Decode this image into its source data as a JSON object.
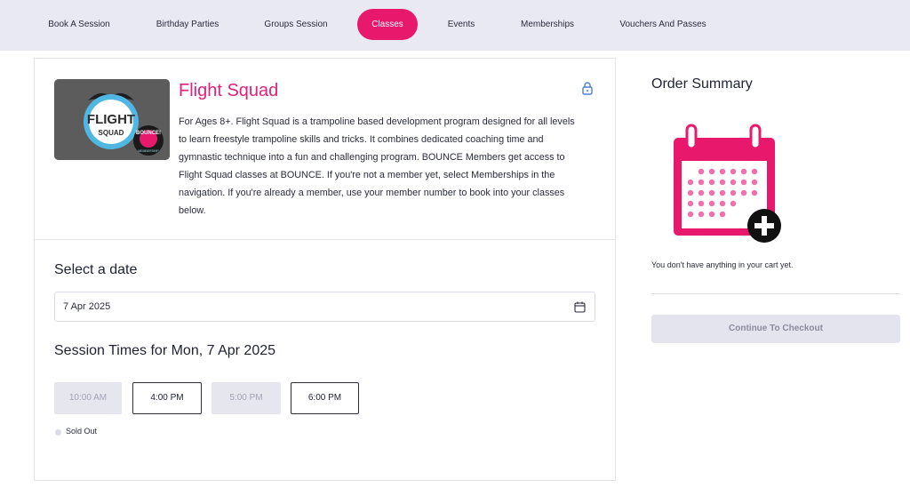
{
  "nav": {
    "items": [
      {
        "label": "Book A Session",
        "active": false
      },
      {
        "label": "Birthday Parties",
        "active": false
      },
      {
        "label": "Groups Session",
        "active": false
      },
      {
        "label": "Classes",
        "active": true
      },
      {
        "label": "Events",
        "active": false
      },
      {
        "label": "Memberships",
        "active": false
      },
      {
        "label": "Vouchers And Passes",
        "active": false
      }
    ]
  },
  "class": {
    "title": "Flight Squad",
    "description": "For Ages 8+. Flight Squad is a trampoline based development program designed for all levels to learn freestyle trampoline skills and tricks. It combines dedicated coaching time and gymnastic technique into a fun and challenging program. BOUNCE Members get access to Flight Squad classes at BOUNCE. If you're not a member yet, select Memberships in the navigation. If you're already a member, use your member number to book into your classes below.",
    "image_text": {
      "top": "FLIGHT",
      "bottom": "SQUAD",
      "badge": "BOUNCE!",
      "badge_sub": "MEMBERSHIP"
    },
    "lock_icon": "lock-icon"
  },
  "date": {
    "label": "Select a date",
    "value": "7 Apr 2025",
    "icon": "calendar-icon"
  },
  "sessions": {
    "title": "Session Times for Mon, 7 Apr 2025",
    "slots": [
      {
        "time": "10:00 AM",
        "status": "sold-out"
      },
      {
        "time": "4:00 PM",
        "status": "available"
      },
      {
        "time": "5:00 PM",
        "status": "sold-out"
      },
      {
        "time": "6:00 PM",
        "status": "available"
      }
    ],
    "legend": "Sold Out"
  },
  "order": {
    "title": "Order Summary",
    "empty_text": "You don't have anything in your cart yet.",
    "checkout_label": "Continue To Checkout",
    "illustration_icon": "calendar-add-icon"
  },
  "colors": {
    "accent": "#e8186d",
    "nav_bg": "#e9e9f3",
    "sold_out_bg": "#e6e6ef",
    "disabled_button_bg": "#e4e4ee"
  }
}
